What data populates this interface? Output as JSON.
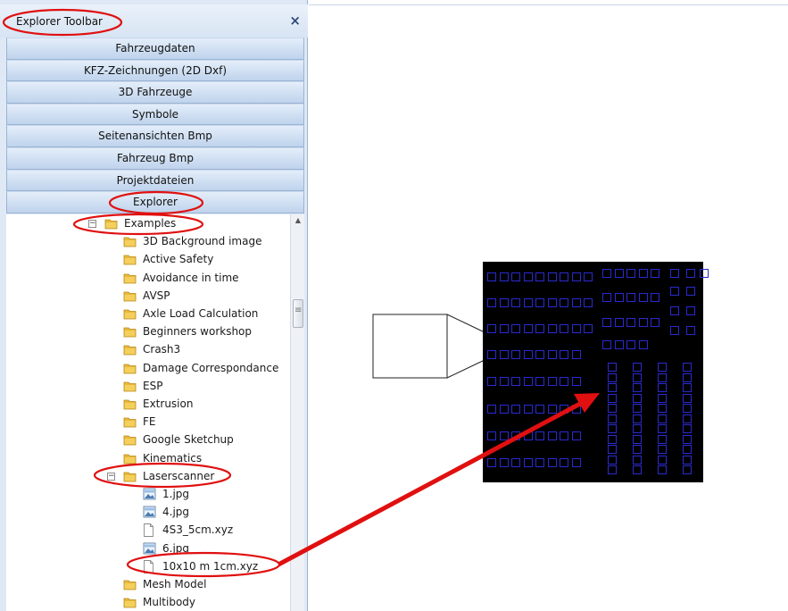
{
  "panel": {
    "title": "Explorer Toolbar",
    "close_icon": "×",
    "sections": [
      "Fahrzeugdaten",
      "KFZ-Zeichnungen (2D Dxf)",
      "3D Fahrzeuge",
      "Symbole",
      "Seitenansichten Bmp",
      "Fahrzeug Bmp",
      "Projektdateien",
      "Explorer"
    ]
  },
  "tree": {
    "items": [
      {
        "label": "Examples",
        "icon": "folder-icon",
        "expanded": true
      },
      {
        "label": "3D Background image",
        "icon": "folder-icon"
      },
      {
        "label": "Active Safety",
        "icon": "folder-icon"
      },
      {
        "label": "Avoidance in time",
        "icon": "folder-icon"
      },
      {
        "label": "AVSP",
        "icon": "folder-icon"
      },
      {
        "label": "Axle Load Calculation",
        "icon": "folder-icon"
      },
      {
        "label": "Beginners workshop",
        "icon": "folder-icon"
      },
      {
        "label": "Crash3",
        "icon": "folder-icon"
      },
      {
        "label": "Damage Correspondance",
        "icon": "folder-icon"
      },
      {
        "label": "ESP",
        "icon": "folder-icon"
      },
      {
        "label": "Extrusion",
        "icon": "folder-icon"
      },
      {
        "label": "FE",
        "icon": "folder-icon"
      },
      {
        "label": "Google Sketchup",
        "icon": "folder-icon"
      },
      {
        "label": "Kinematics",
        "icon": "folder-icon"
      },
      {
        "label": "Laserscanner",
        "icon": "folder-icon",
        "expanded": true
      },
      {
        "label": "1.jpg",
        "icon": "image-file-icon"
      },
      {
        "label": "4.jpg",
        "icon": "image-file-icon"
      },
      {
        "label": "4S3_5cm.xyz",
        "icon": "document-file-icon"
      },
      {
        "label": "6.jpg",
        "icon": "image-file-icon"
      },
      {
        "label": "10x10 m 1cm.xyz",
        "icon": "document-file-icon"
      },
      {
        "label": "Mesh Model",
        "icon": "folder-icon"
      },
      {
        "label": "Multibody",
        "icon": "folder-icon"
      }
    ]
  },
  "colors": {
    "annotation_red": "#e01010",
    "grid_background": "#000000",
    "grid_points": "#2a2ad0"
  }
}
